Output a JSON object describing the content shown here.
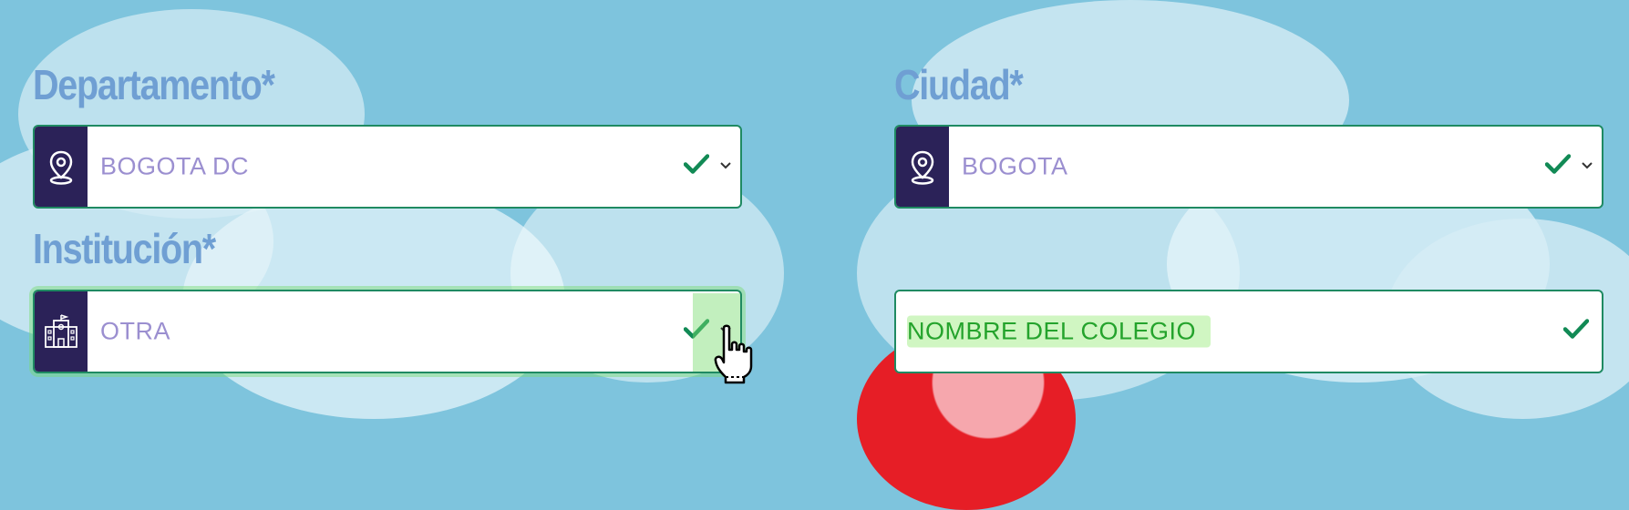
{
  "departamento": {
    "label": "Departamento*",
    "value": "BOGOTA DC",
    "icon": "map-pin-icon",
    "validated": true
  },
  "ciudad": {
    "label": "Ciudad*",
    "value": "BOGOTA",
    "icon": "map-pin-icon",
    "validated": true
  },
  "institucion": {
    "label": "Institución*",
    "value": "OTRA",
    "icon": "school-building-icon",
    "validated": true
  },
  "colegio": {
    "value": "NOMBRE DEL COLEGIO",
    "validated": true
  },
  "colors": {
    "background": "#7ec4dd",
    "label": "#6f9fd3",
    "icon_block": "#2b2258",
    "border": "#1f8a62",
    "check": "#128a55",
    "value_text": "#9b8fd0",
    "highlight_text": "#24a32c"
  }
}
